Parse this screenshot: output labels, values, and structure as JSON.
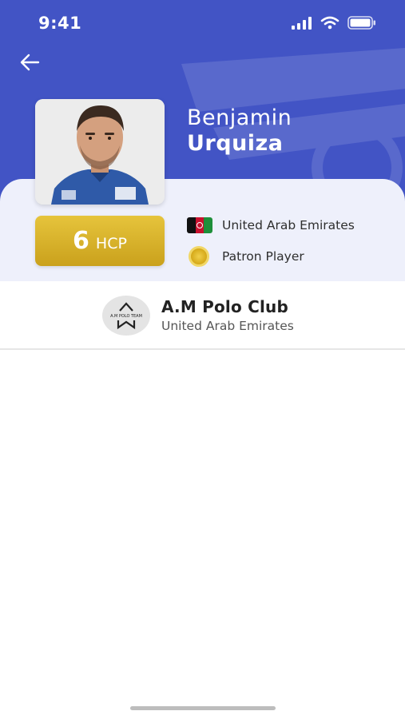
{
  "status_bar": {
    "time": "9:41"
  },
  "player": {
    "first_name": "Benjamin",
    "last_name": "Urquiza",
    "handicap_value": "6",
    "handicap_unit": "HCP",
    "country": "United Arab Emirates",
    "role": "Patron Player"
  },
  "club": {
    "name": "A.M Polo Club",
    "country": "United Arab Emirates",
    "logo_text": "A.M POLO TEAM"
  },
  "icons": {
    "back": "arrow-left-icon",
    "signal": "cellular-signal-icon",
    "wifi": "wifi-icon",
    "battery": "battery-icon",
    "flag": "flag-icon",
    "coin": "gold-coin-icon"
  },
  "colors": {
    "header": "#4254c5",
    "panel": "#eef0fb",
    "gold": "#d4ad27"
  }
}
